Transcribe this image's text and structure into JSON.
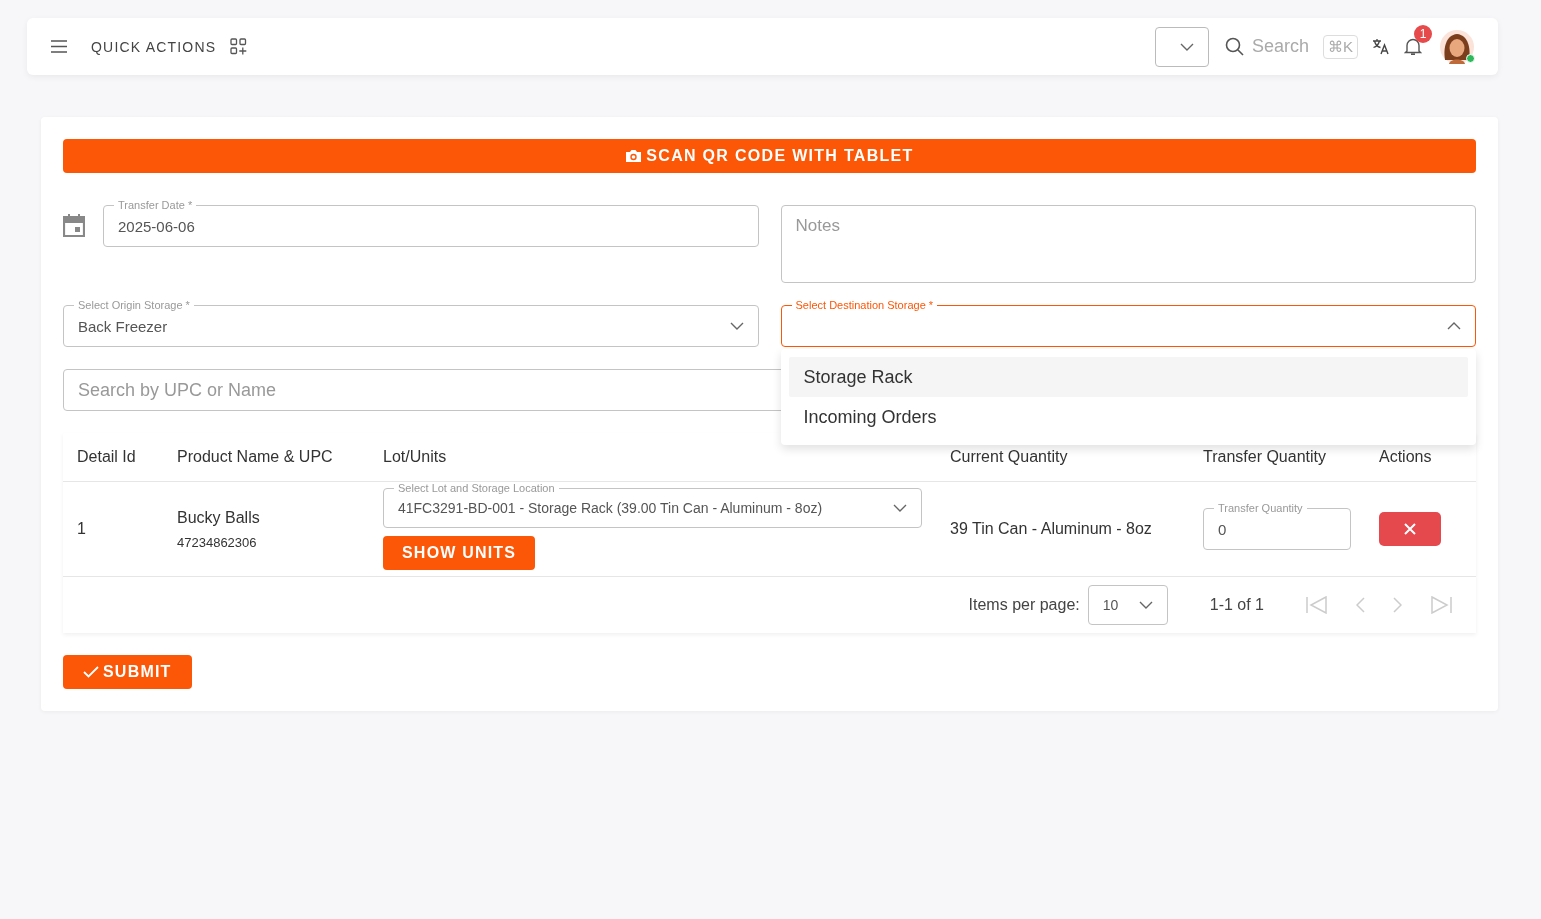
{
  "header": {
    "quick_actions": "QUICK ACTIONS",
    "search_placeholder": "Search",
    "shortcut": "⌘K",
    "notification_count": "1"
  },
  "scan_button": "SCAN QR CODE WITH TABLET",
  "transfer_date": {
    "label": "Transfer Date *",
    "value": "2025-06-06"
  },
  "notes": {
    "placeholder": "Notes"
  },
  "origin": {
    "label": "Select Origin Storage *",
    "value": "Back Freezer"
  },
  "destination": {
    "label": "Select Destination Storage *",
    "expanded": true,
    "options": [
      {
        "label": "Storage Rack",
        "selected": true
      },
      {
        "label": "Incoming Orders",
        "selected": false
      }
    ]
  },
  "product_search": {
    "placeholder": "Search by UPC or Name"
  },
  "table": {
    "columns": [
      "Detail Id",
      "Product Name & UPC",
      "Lot/Units",
      "Current Quantity",
      "Transfer Quantity",
      "Actions"
    ],
    "rows": [
      {
        "detail_id": "1",
        "product_name": "Bucky Balls",
        "upc": "47234862306",
        "lot_label": "Select Lot and Storage Location",
        "lot_value": "41FC3291-BD-001 - Storage Rack (39.00 Tin Can - Aluminum - 8oz)",
        "show_units": "SHOW UNITS",
        "current_quantity": "39 Tin Can - Aluminum - 8oz",
        "transfer_label": "Transfer Quantity",
        "transfer_value": "0"
      }
    ]
  },
  "pagination": {
    "label": "Items per page:",
    "page_size": "10",
    "range": "1-1 of 1"
  },
  "submit": "SUBMIT"
}
